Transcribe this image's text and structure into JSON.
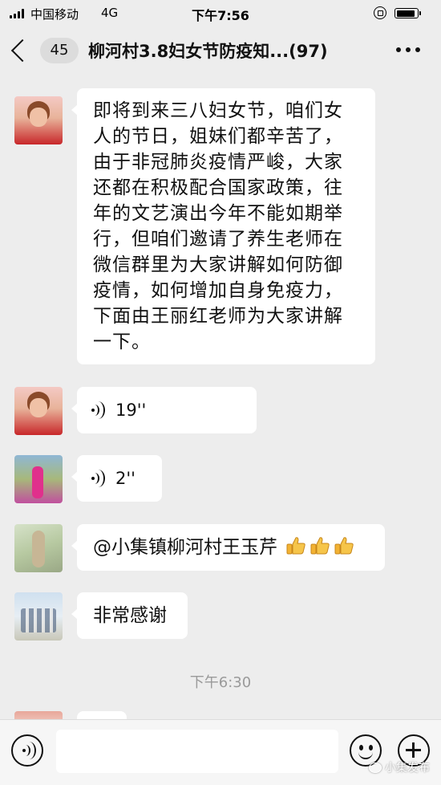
{
  "status_bar": {
    "carrier": "中国移动",
    "network": "4G",
    "time": "下午7:56"
  },
  "nav": {
    "badge": "45",
    "title": "柳河村3.8妇女节防疫知...(97)"
  },
  "messages": [
    {
      "type": "text",
      "lines": [
        "即将到来三八妇女节，咱们女",
        "人的节日，姐妹们都辛苦了，",
        "由于非冠肺炎疫情严峻，大家",
        "还都在积极配合国家政策，往",
        "年的文艺演出今年不能如期举",
        "行，但咱们邀请了养生老师在",
        "微信群里为大家讲解如何防御",
        "疫情，如何增加自身免疫力，",
        "下面由王丽红老师为大家讲解",
        "一下。"
      ]
    },
    {
      "type": "voice",
      "duration": "19''"
    },
    {
      "type": "voice",
      "duration": "2''"
    },
    {
      "type": "text",
      "text": "@小集镇柳河村王玉芹",
      "emoji": "thumbs-up x3"
    },
    {
      "type": "text",
      "text": "非常感谢"
    }
  ],
  "timestamp": "下午6:30",
  "watermark": "小集发布",
  "icons": {
    "back": "chevron-left-icon",
    "more": "more-dots-icon",
    "voice": "voice-wave-icon",
    "emoji": "smile-icon",
    "add": "plus-circle-icon"
  },
  "colors": {
    "background": "#ededed",
    "bubble": "#ffffff",
    "input_bar": "#f6f6f6"
  }
}
